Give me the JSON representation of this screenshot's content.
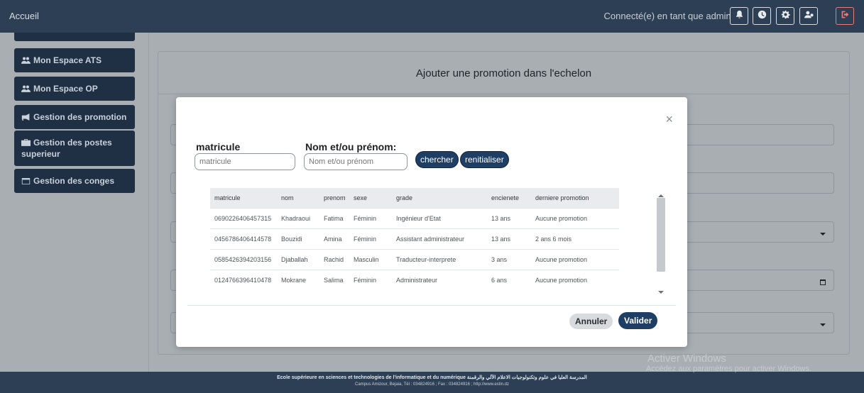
{
  "topbar": {
    "home_label": "Accueil",
    "user_text": "Connecté(e) en tant que admin1"
  },
  "sidebar": {
    "items": [
      {
        "label": "Mon Espace ATS",
        "icon": "users-icon"
      },
      {
        "label": "Mon Espace OP",
        "icon": "users-icon"
      },
      {
        "label": "Gestion des promotion",
        "icon": "megaphone-icon"
      },
      {
        "label": "Gestion des postes superieur",
        "icon": "briefcase-icon"
      },
      {
        "label": "Gestion des conges",
        "icon": "calendar-icon"
      }
    ]
  },
  "page": {
    "title": "Ajouter une promotion dans l'echelon"
  },
  "modal": {
    "matricule_label": "matricule",
    "matricule_placeholder": "matricule",
    "name_label": "Nom et/ou prénom:",
    "name_placeholder": "Nom et/ou prénom",
    "search_button": "chercher",
    "reset_button": "renitialiser",
    "close_symbol": "×",
    "cancel_button": "Annuler",
    "validate_button": "Valider",
    "table": {
      "headers": [
        "matricule",
        "nom",
        "prenom",
        "sexe",
        "grade",
        "encienete",
        "derniere promotion"
      ],
      "rows": [
        [
          "0690226406457315",
          "Khadraoui",
          "Fatima",
          "Féminin",
          "Ingénieur d'Etat",
          "13 ans",
          "Aucune promotion"
        ],
        [
          "0456786406414578",
          "Bouzidi",
          "Amina",
          "Féminin",
          "Assistant administrateur",
          "13 ans",
          "2 ans 6 mois"
        ],
        [
          "0585426394203156",
          "Djaballah",
          "Rachid",
          "Masculin",
          "Traducteur-interprete",
          "3 ans",
          "Aucune promotion"
        ],
        [
          "0124766396410478",
          "Mokrane",
          "Salima",
          "Féminin",
          "Administrateur",
          "6 ans",
          "Aucune promotion"
        ]
      ]
    }
  },
  "footer": {
    "line1": "Ecole supérieure en sciences et technologies de l'informatique et du numérique المدرسة العليا في علوم وتكنولوجيات الاعلام الآلي والرقمنة",
    "line2": "Campus Amizour, Bejaia, Tél : 034824916 ; Fax : 034824916 ; http://www.estin.dz"
  },
  "watermark": {
    "title": "Activer Windows",
    "subtitle": "Accédez aux paramètres pour activer Windows."
  },
  "colors": {
    "navbar": "#2d3f55",
    "sidebar_button": "#1f2f44",
    "primary_button": "#1f3e63",
    "overlay_bg": "#a9aeb3"
  }
}
